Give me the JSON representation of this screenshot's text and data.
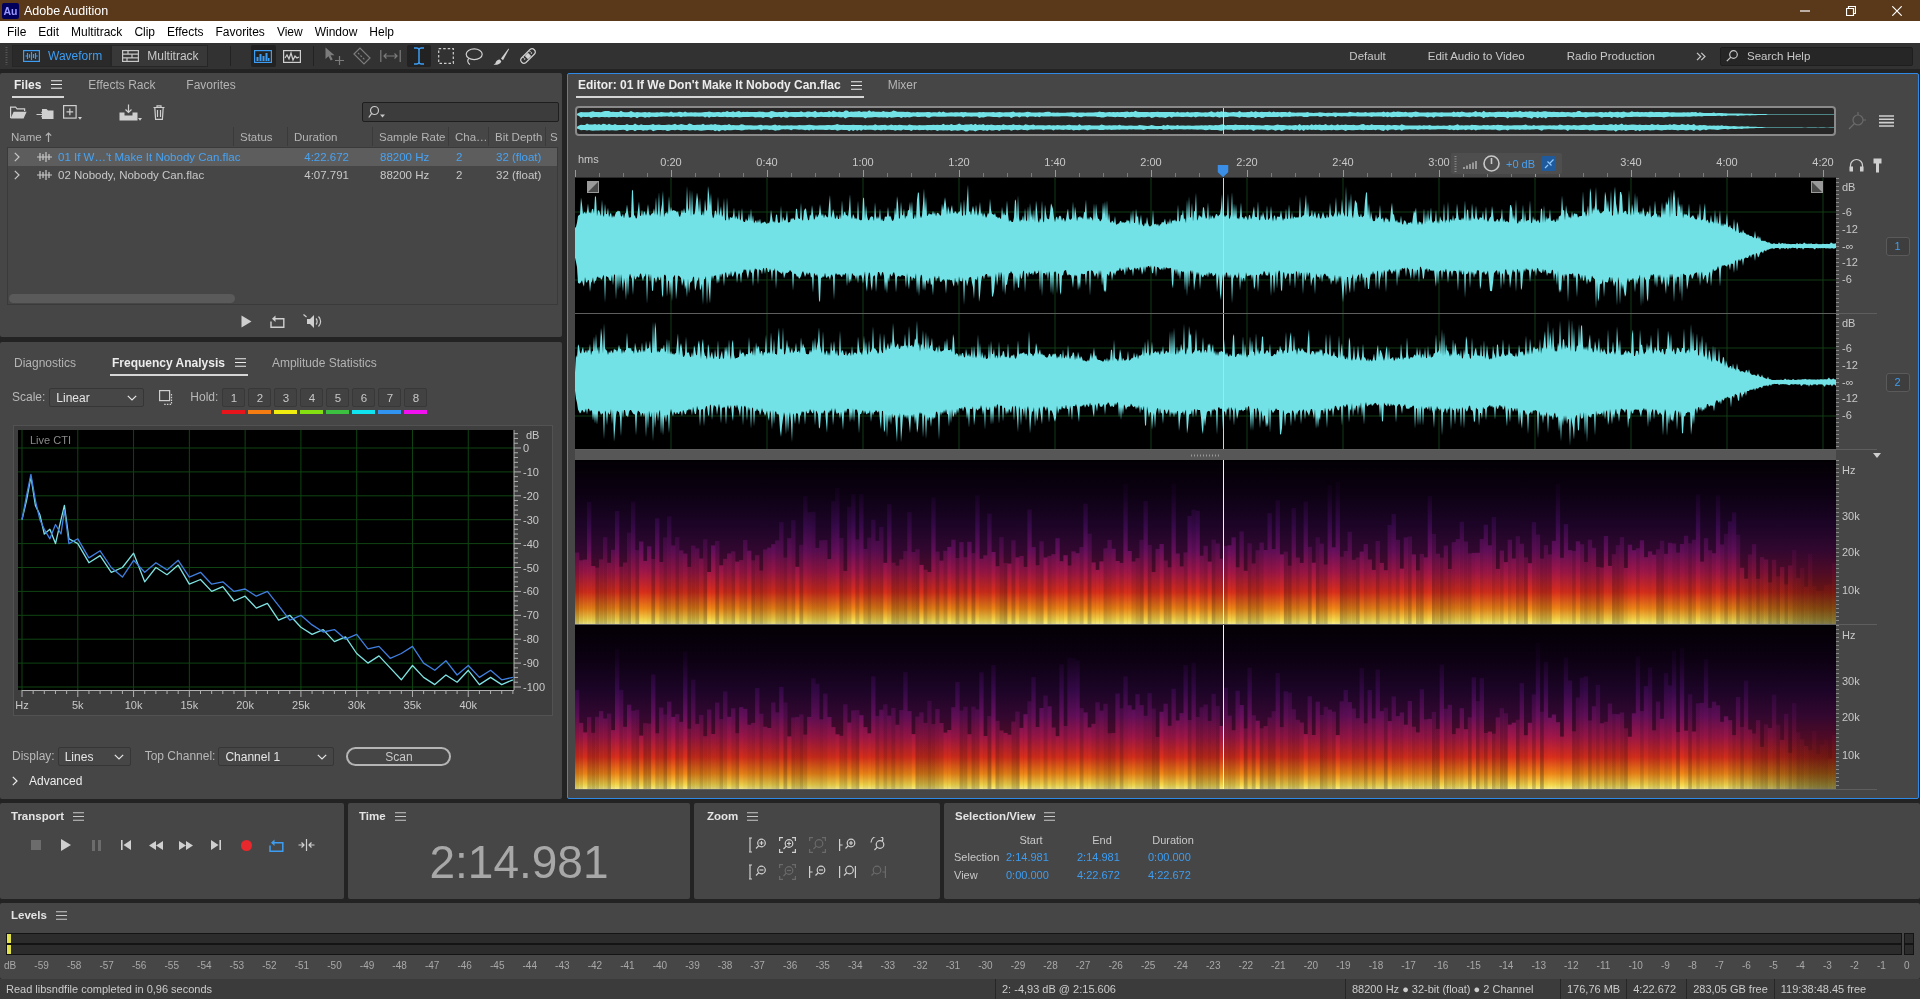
{
  "window": {
    "badge": "Au",
    "title": "Adobe Audition"
  },
  "menu": [
    "File",
    "Edit",
    "Multitrack",
    "Clip",
    "Effects",
    "Favorites",
    "View",
    "Window",
    "Help"
  ],
  "toolbar": {
    "views": [
      {
        "kind": "waveform",
        "label": "Waveform",
        "selected": true
      },
      {
        "kind": "multitrack",
        "label": "Multitrack",
        "selected": false
      }
    ],
    "displays": [
      {
        "kind": "spectral-frequency",
        "selected": true
      },
      {
        "kind": "spectral-pitch",
        "selected": false
      }
    ],
    "tools": [
      {
        "kind": "move",
        "selected": false,
        "disabled": true
      },
      {
        "kind": "razor",
        "selected": false,
        "disabled": true
      },
      {
        "kind": "slip",
        "selected": false,
        "disabled": true
      },
      {
        "kind": "time-selection",
        "selected": true,
        "disabled": false
      },
      {
        "kind": "marquee",
        "selected": false,
        "disabled": false
      },
      {
        "kind": "lasso",
        "selected": false,
        "disabled": false
      },
      {
        "kind": "brush",
        "selected": false,
        "disabled": false
      },
      {
        "kind": "healing",
        "selected": false,
        "disabled": false
      }
    ],
    "workspaces": [
      "Default",
      "Edit Audio to Video",
      "Radio Production"
    ],
    "search": {
      "placeholder": "Search Help"
    }
  },
  "files": {
    "tabs": [
      {
        "label": "Files",
        "selected": true
      },
      {
        "label": "Effects Rack",
        "selected": false
      },
      {
        "label": "Favorites",
        "selected": false
      }
    ],
    "columns": [
      "Name",
      "Status",
      "Duration",
      "Sample Rate",
      "Cha…",
      "Bit Depth",
      "S"
    ],
    "rows": [
      {
        "name": "01 If W…'t Make It Nobody Can.flac",
        "duration": "4:22.672",
        "sample_rate": "88200 Hz",
        "channels": "2",
        "bit_depth": "32 (float)",
        "selected": true,
        "expanded": false
      },
      {
        "name": "02 Nobody, Nobody Can.flac",
        "duration": "4:07.791",
        "sample_rate": "88200 Hz",
        "channels": "2",
        "bit_depth": "32 (float)",
        "selected": false,
        "expanded": false
      }
    ]
  },
  "frequency_analysis": {
    "tabs": [
      {
        "label": "Diagnostics",
        "selected": false
      },
      {
        "label": "Frequency Analysis",
        "selected": true
      },
      {
        "label": "Amplitude Statistics",
        "selected": false
      }
    ],
    "scale": {
      "label": "Scale:",
      "value": "Linear"
    },
    "hold": {
      "label": "Hold:",
      "buttons": [
        {
          "label": "1",
          "color": "#e8141c"
        },
        {
          "label": "2",
          "color": "#f57c10"
        },
        {
          "label": "3",
          "color": "#f0ec10"
        },
        {
          "label": "4",
          "color": "#84e010"
        },
        {
          "label": "5",
          "color": "#3cc040"
        },
        {
          "label": "6",
          "color": "#10e4f0"
        },
        {
          "label": "7",
          "color": "#3094f0"
        },
        {
          "label": "8",
          "color": "#f010f0"
        }
      ]
    },
    "plot_label": "Live CTI",
    "chart_data": {
      "type": "line",
      "ylabel": "dB",
      "grid": true,
      "x": [
        0,
        400,
        800,
        1200,
        1600,
        2000,
        2500,
        3000,
        3500,
        3800,
        4200,
        5000,
        6000,
        7000,
        8000,
        9000,
        10000,
        11000,
        12000,
        13000,
        14000,
        15000,
        16000,
        17000,
        18000,
        19000,
        20000,
        21000,
        22000,
        23000,
        24000,
        25000,
        26000,
        27000,
        28000,
        29000,
        30000,
        31000,
        32000,
        33000,
        34000,
        35000,
        36000,
        37000,
        38000,
        39000,
        40000,
        41000,
        42000,
        43000,
        44000
      ],
      "series": [
        {
          "color": "#7fe3e3",
          "values": [
            -30,
            -22,
            -12,
            -24,
            -28,
            -36,
            -34,
            -40,
            -30,
            -24,
            -38,
            -40,
            -48,
            -45,
            -52,
            -50,
            -44,
            -56,
            -50,
            -53,
            -49,
            -57,
            -55,
            -60,
            -58,
            -64,
            -62,
            -67,
            -65,
            -72,
            -70,
            -75,
            -78,
            -76,
            -81,
            -79,
            -86,
            -90,
            -87,
            -92,
            -97,
            -91,
            -96,
            -99,
            -95,
            -98,
            -93,
            -99,
            -96,
            -99,
            -97
          ]
        },
        {
          "color": "#3f7fe0",
          "values": [
            -30,
            -20,
            -11,
            -22,
            -30,
            -34,
            -38,
            -32,
            -36,
            -26,
            -40,
            -38,
            -46,
            -43,
            -50,
            -54,
            -47,
            -52,
            -48,
            -51,
            -47,
            -54,
            -52,
            -57,
            -56,
            -60,
            -59,
            -62,
            -60,
            -66,
            -72,
            -70,
            -74,
            -77,
            -76,
            -80,
            -78,
            -84,
            -83,
            -88,
            -86,
            -83,
            -90,
            -93,
            -89,
            -95,
            -91,
            -96,
            -93,
            -97,
            -96
          ]
        }
      ],
      "xlim": [
        0,
        44100
      ],
      "ylim": [
        -100,
        0
      ],
      "xticks": [
        {
          "value": 0,
          "label": "Hz"
        },
        {
          "value": 5000,
          "label": "5k"
        },
        {
          "value": 10000,
          "label": "10k"
        },
        {
          "value": 15000,
          "label": "15k"
        },
        {
          "value": 20000,
          "label": "20k"
        },
        {
          "value": 25000,
          "label": "25k"
        },
        {
          "value": 30000,
          "label": "30k"
        },
        {
          "value": 35000,
          "label": "35k"
        },
        {
          "value": 40000,
          "label": "40k"
        }
      ],
      "yticks": [
        0,
        -10,
        -20,
        -30,
        -40,
        -50,
        -60,
        -70,
        -80,
        -90,
        -100
      ]
    },
    "display": {
      "label": "Display:",
      "value": "Lines"
    },
    "top_channel": {
      "label": "Top Channel:",
      "value": "Channel 1"
    },
    "scan_button": "Scan",
    "advanced": {
      "label": "Advanced",
      "expanded": false
    }
  },
  "editor": {
    "tabs": [
      {
        "label": "Editor: 01 If We Don't Make It Nobody Can.flac",
        "selected": true
      },
      {
        "label": "Mixer",
        "selected": false
      }
    ],
    "playhead": {
      "level": 0.514
    },
    "ruler": {
      "unit": "hms",
      "items": [
        {
          "kind": "tick",
          "label": "0:20"
        },
        {
          "kind": "tick",
          "label": "0:40"
        },
        {
          "kind": "tick",
          "label": "1:00"
        },
        {
          "kind": "tick",
          "label": "1:20"
        },
        {
          "kind": "tick",
          "label": "1:40"
        },
        {
          "kind": "tick",
          "label": "2:00"
        },
        {
          "kind": "tick",
          "label": "2:20"
        },
        {
          "kind": "tick",
          "label": "2:40"
        },
        {
          "kind": "tick",
          "label": "3:00"
        },
        {
          "kind": "hud",
          "volume": "+0 dB"
        },
        {
          "kind": "tick",
          "label": "3:40"
        },
        {
          "kind": "tick",
          "label": "4:00"
        },
        {
          "kind": "tick",
          "label": "4:20"
        }
      ]
    },
    "channels": [
      {
        "button": "1",
        "scale": [
          "dB",
          "-6",
          "-12",
          "-∞",
          "-12",
          "-6"
        ]
      },
      {
        "button": "2",
        "scale": [
          "dB",
          "-6",
          "-12",
          "-∞",
          "-12",
          "-6"
        ]
      }
    ],
    "spectral_channels": [
      {
        "scale": [
          "Hz",
          "30k",
          "20k",
          "10k"
        ]
      },
      {
        "scale": [
          "Hz",
          "30k",
          "20k",
          "10k"
        ]
      }
    ]
  },
  "transport": {
    "title": "Transport",
    "buttons": [
      {
        "kind": "stop",
        "on": false,
        "disabled": true
      },
      {
        "kind": "play",
        "on": false,
        "disabled": false
      },
      {
        "kind": "pause",
        "on": false,
        "disabled": true
      },
      {
        "kind": "to-start",
        "on": false,
        "disabled": false
      },
      {
        "kind": "rewind",
        "on": false,
        "disabled": false
      },
      {
        "kind": "fast-forward",
        "on": false,
        "disabled": false
      },
      {
        "kind": "to-end",
        "on": false,
        "disabled": false
      },
      {
        "kind": "record",
        "on": false,
        "disabled": false
      },
      {
        "kind": "loop",
        "on": true,
        "disabled": false
      },
      {
        "kind": "skip",
        "on": false,
        "disabled": false
      }
    ]
  },
  "time": {
    "title": "Time",
    "value": "2:14.981"
  },
  "zoom": {
    "title": "Zoom",
    "buttons": [
      {
        "kind": "amplitude-in",
        "disabled": false
      },
      {
        "kind": "frame-in",
        "disabled": false
      },
      {
        "kind": "frame-center",
        "disabled": true
      },
      {
        "kind": "bracket-in",
        "disabled": false
      },
      {
        "kind": "rotate",
        "disabled": false
      },
      {
        "kind": "amplitude-out",
        "disabled": false
      },
      {
        "kind": "frame-out",
        "disabled": true
      },
      {
        "kind": "bracket-out",
        "disabled": false
      },
      {
        "kind": "double-bracket",
        "disabled": false
      },
      {
        "kind": "bracket-right",
        "disabled": true
      }
    ]
  },
  "selection_view": {
    "title": "Selection/View",
    "columns": [
      "Start",
      "End",
      "Duration"
    ],
    "rows": [
      {
        "label": "Selection",
        "start": "2:14.981",
        "end": "2:14.981",
        "duration": "0:00.000"
      },
      {
        "label": "View",
        "start": "0:00.000",
        "end": "4:22.672",
        "duration": "4:22.672"
      }
    ]
  },
  "levels": {
    "title": "Levels",
    "meter": {
      "level": 0.002
    },
    "scale": [
      "dB",
      "-59",
      "-58",
      "-57",
      "-56",
      "-55",
      "-54",
      "-53",
      "-52",
      "-51",
      "-50",
      "-49",
      "-48",
      "-47",
      "-46",
      "-45",
      "-44",
      "-43",
      "-42",
      "-41",
      "-40",
      "-39",
      "-38",
      "-37",
      "-36",
      "-35",
      "-34",
      "-33",
      "-32",
      "-31",
      "-30",
      "-29",
      "-28",
      "-27",
      "-26",
      "-25",
      "-24",
      "-23",
      "-22",
      "-21",
      "-20",
      "-19",
      "-18",
      "-17",
      "-16",
      "-15",
      "-14",
      "-13",
      "-12",
      "-11",
      "-10",
      "-9",
      "-8",
      "-7",
      "-6",
      "-5",
      "-4",
      "-3",
      "-2",
      "-1",
      "0"
    ]
  },
  "status_bar": {
    "message": "Read libsndfile completed in 0,96 seconds",
    "cursor": "2: -4,93 dB @ 2:15.606",
    "format": "88200 Hz ● 32-bit (float) ● 2 Channel",
    "size": "176,76 MB",
    "duration": "4:22.672",
    "disk_free": "283,05 GB free",
    "time_free": "119:38:48.45 free"
  }
}
